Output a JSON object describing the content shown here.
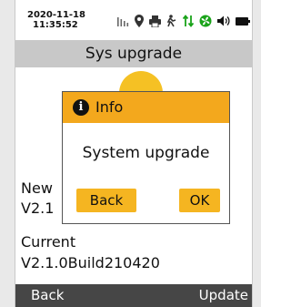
{
  "status_bar": {
    "date": "2020-11-18",
    "time": "11:35:52",
    "icons": [
      "signal-bars-icon",
      "location-pin-icon",
      "printer-icon",
      "nfc-icon",
      "data-arrows-icon",
      "fan-icon",
      "speaker-icon",
      "battery-icon"
    ]
  },
  "title": "Sys upgrade",
  "content": {
    "new_label": "New",
    "new_value": "V2.1",
    "current_label": "Current",
    "current_value": "V2.1.0Build210420"
  },
  "dialog": {
    "title": "Info",
    "message": "System upgrade",
    "back_label": "Back",
    "ok_label": "OK"
  },
  "softkeys": {
    "left": "Back",
    "right": "Update"
  },
  "colors": {
    "accent": "#f3a81d",
    "button": "#f5b521",
    "title_bar": "#c8c8c8",
    "bottom_bar": "#464646"
  }
}
